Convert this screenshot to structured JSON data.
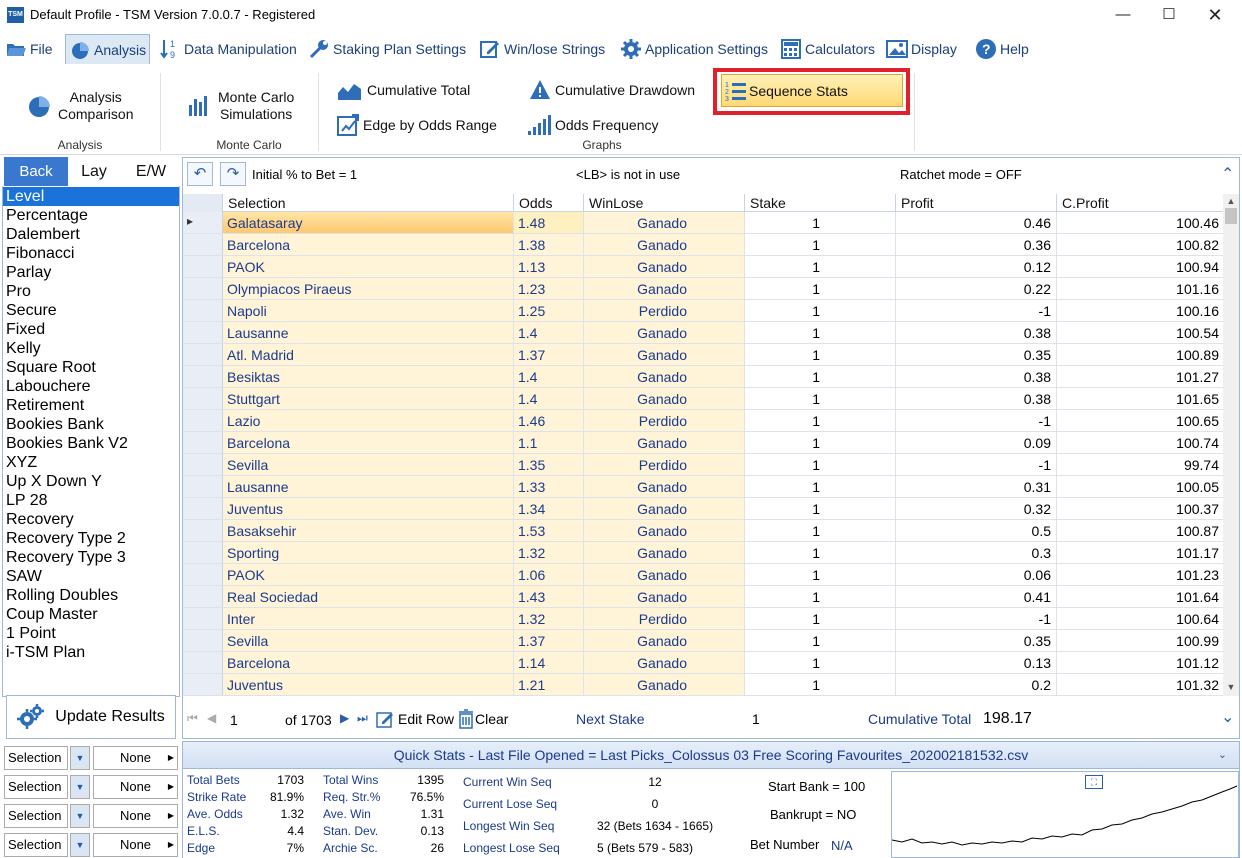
{
  "window": {
    "title": "Default Profile  - TSM Version 7.0.0.7 - Registered",
    "icon_text": "TSM"
  },
  "menu": [
    {
      "label": "File",
      "icon": "folder-open-icon"
    },
    {
      "label": "Analysis",
      "icon": "pie-chart-icon",
      "active": true
    },
    {
      "label": "Data Manipulation",
      "icon": "sort-numeric-icon"
    },
    {
      "label": "Staking Plan Settings",
      "icon": "wrench-icon"
    },
    {
      "label": "Win/lose Strings",
      "icon": "edit-icon"
    },
    {
      "label": "Application Settings",
      "icon": "gear-icon"
    },
    {
      "label": "Calculators",
      "icon": "calculator-icon"
    },
    {
      "label": "Display",
      "icon": "image-icon"
    },
    {
      "label": "Help",
      "icon": "help-icon"
    }
  ],
  "ribbon": {
    "analysis_comparison": "Analysis\nComparison",
    "monte_carlo_sims": "Monte Carlo\nSimulations",
    "cumulative_total": "Cumulative Total",
    "cumulative_drawdown": "Cumulative Drawdown",
    "sequence_stats": "Sequence Stats",
    "edge_by_odds": "Edge by Odds Range",
    "odds_frequency": "Odds Frequency",
    "group_analysis": "Analysis",
    "group_monte_carlo": "Monte Carlo",
    "group_graphs": "Graphs"
  },
  "tabs": [
    "Back",
    "Lay",
    "E/W"
  ],
  "plans": [
    "Level",
    "Percentage",
    "Dalembert",
    "Fibonacci",
    "Parlay",
    "Pro",
    "Secure",
    "Fixed",
    "Kelly",
    "Square Root",
    "Labouchere",
    "Retirement",
    "Bookies Bank",
    "Bookies Bank V2",
    "XYZ",
    "Up X Down Y",
    "LP 28",
    "Recovery",
    "Recovery Type 2",
    "Recovery Type 3",
    "SAW",
    "Rolling Doubles",
    "Coup Master",
    "1 Point",
    "i-TSM Plan"
  ],
  "update_results": "Update Results",
  "filters": [
    {
      "field": "Selection",
      "value": "None"
    },
    {
      "field": "Selection",
      "value": "None"
    },
    {
      "field": "Selection",
      "value": "None"
    },
    {
      "field": "Selection",
      "value": "None"
    }
  ],
  "grid_top": {
    "initial_pct": "Initial % to Bet = 1",
    "lb_status": "<LB> is not in use",
    "ratchet": "Ratchet mode = OFF"
  },
  "columns": [
    "Selection",
    "Odds",
    "WinLose",
    "Stake",
    "Profit",
    "C.Profit"
  ],
  "rows": [
    [
      "Galatasaray",
      "1.48",
      "Ganado",
      "1",
      "0.46",
      "100.46"
    ],
    [
      "Barcelona",
      "1.38",
      "Ganado",
      "1",
      "0.36",
      "100.82"
    ],
    [
      "PAOK",
      "1.13",
      "Ganado",
      "1",
      "0.12",
      "100.94"
    ],
    [
      "Olympiacos Piraeus",
      "1.23",
      "Ganado",
      "1",
      "0.22",
      "101.16"
    ],
    [
      "Napoli",
      "1.25",
      "Perdido",
      "1",
      "-1",
      "100.16"
    ],
    [
      "Lausanne",
      "1.4",
      "Ganado",
      "1",
      "0.38",
      "100.54"
    ],
    [
      "Atl. Madrid",
      "1.37",
      "Ganado",
      "1",
      "0.35",
      "100.89"
    ],
    [
      "Besiktas",
      "1.4",
      "Ganado",
      "1",
      "0.38",
      "101.27"
    ],
    [
      "Stuttgart",
      "1.4",
      "Ganado",
      "1",
      "0.38",
      "101.65"
    ],
    [
      "Lazio",
      "1.46",
      "Perdido",
      "1",
      "-1",
      "100.65"
    ],
    [
      "Barcelona",
      "1.1",
      "Ganado",
      "1",
      "0.09",
      "100.74"
    ],
    [
      "Sevilla",
      "1.35",
      "Perdido",
      "1",
      "-1",
      "99.74"
    ],
    [
      "Lausanne",
      "1.33",
      "Ganado",
      "1",
      "0.31",
      "100.05"
    ],
    [
      "Juventus",
      "1.34",
      "Ganado",
      "1",
      "0.32",
      "100.37"
    ],
    [
      "Basaksehir",
      "1.53",
      "Ganado",
      "1",
      "0.5",
      "100.87"
    ],
    [
      "Sporting",
      "1.32",
      "Ganado",
      "1",
      "0.3",
      "101.17"
    ],
    [
      "PAOK",
      "1.06",
      "Ganado",
      "1",
      "0.06",
      "101.23"
    ],
    [
      "Real Sociedad",
      "1.43",
      "Ganado",
      "1",
      "0.41",
      "101.64"
    ],
    [
      "Inter",
      "1.32",
      "Perdido",
      "1",
      "-1",
      "100.64"
    ],
    [
      "Sevilla",
      "1.37",
      "Ganado",
      "1",
      "0.35",
      "100.99"
    ],
    [
      "Barcelona",
      "1.14",
      "Ganado",
      "1",
      "0.13",
      "101.12"
    ],
    [
      "Juventus",
      "1.21",
      "Ganado",
      "1",
      "0.2",
      "101.32"
    ]
  ],
  "grid_bottom": {
    "record": "1",
    "of_total": "of 1703",
    "edit_row": "Edit Row",
    "clear": "Clear",
    "next_stake_label": "Next Stake",
    "next_stake": "1",
    "cumulative_label": "Cumulative Total",
    "cumulative_value": "198.17"
  },
  "quick_stats": {
    "title": "Quick Stats - Last File Opened = Last Picks_Colossus 03 Free Scoring Favourites_202002181532.csv",
    "col1": [
      [
        "Total Bets",
        "1703"
      ],
      [
        "Strike Rate",
        "81.9%"
      ],
      [
        "Ave. Odds",
        "1.32"
      ],
      [
        "E.L.S.",
        "4.4"
      ],
      [
        "Edge",
        "7%"
      ]
    ],
    "col2": [
      [
        "Total Wins",
        "1395"
      ],
      [
        "Req. Str.%",
        "76.5%"
      ],
      [
        "Ave. Win",
        "1.31"
      ],
      [
        "Stan. Dev.",
        "0.13"
      ],
      [
        "Archie Sc.",
        "26"
      ]
    ],
    "col3": [
      [
        "Current Win Seq",
        "12"
      ],
      [
        "Current Lose Seq",
        "0"
      ],
      [
        "Longest Win Seq",
        "32  (Bets 1634 - 1665)"
      ],
      [
        "Longest Lose Seq",
        "5  (Bets 579 - 583)"
      ]
    ],
    "start_bank": "Start Bank = 100",
    "bankrupt": "Bankrupt = NO",
    "bet_number_label": "Bet Number",
    "bet_number": "N/A"
  },
  "colors": {
    "accent": "#1a73d9",
    "highlight_red": "#e0202a",
    "cell_bg": "#fff4d8",
    "link_text": "#1b3a8c"
  }
}
